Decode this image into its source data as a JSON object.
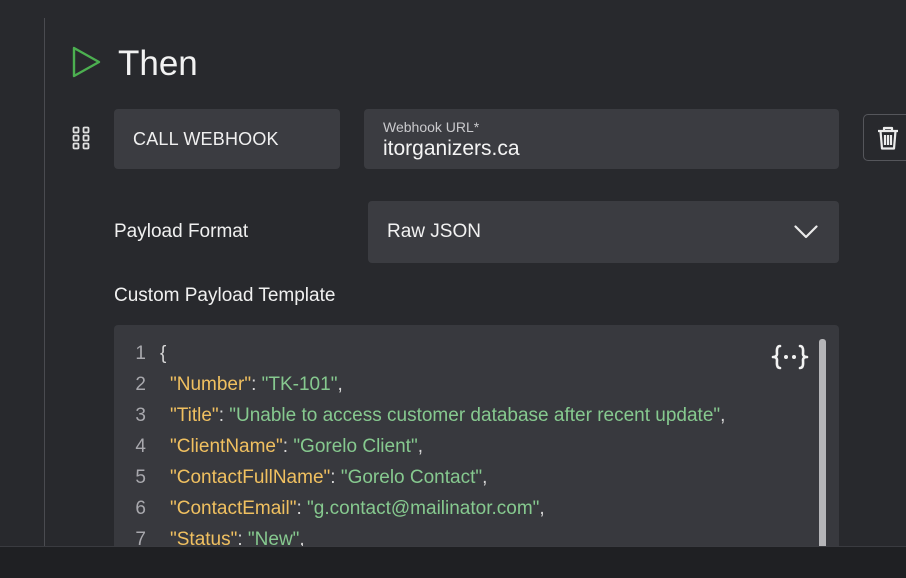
{
  "section": {
    "title": "Then"
  },
  "action": {
    "type_label": "CALL WEBHOOK",
    "url_label": "Webhook URL*",
    "url_value": "itorganizers.ca"
  },
  "payload": {
    "format_label": "Payload Format",
    "format_value": "Raw JSON",
    "template_label": "Custom Payload Template"
  },
  "editor": {
    "lines": [
      {
        "n": "1",
        "brace": "{"
      },
      {
        "n": "2",
        "key": "\"Number\"",
        "value": "\"TK-101\""
      },
      {
        "n": "3",
        "key": "\"Title\"",
        "value": "\"Unable to access customer database after recent update\""
      },
      {
        "n": "4",
        "key": "\"ClientName\"",
        "value": "\"Gorelo Client\""
      },
      {
        "n": "5",
        "key": "\"ContactFullName\"",
        "value": "\"Gorelo Contact\""
      },
      {
        "n": "6",
        "key": "\"ContactEmail\"",
        "value": "\"g.contact@mailinator.com\""
      },
      {
        "n": "7",
        "key": "\"Status\"",
        "value": "\"New\""
      }
    ],
    "colon": ": ",
    "comma": ","
  },
  "icons": {
    "then": "play-outline-icon",
    "drag": "drag-handle-icon",
    "delete": "trash-icon",
    "chevron": "chevron-down-icon",
    "format": "format-json-icon"
  },
  "colors": {
    "background": "#28292d",
    "field": "#3b3c41",
    "play_icon": "#4caf50",
    "json_key": "#f0c060",
    "json_string": "#86c98f"
  }
}
